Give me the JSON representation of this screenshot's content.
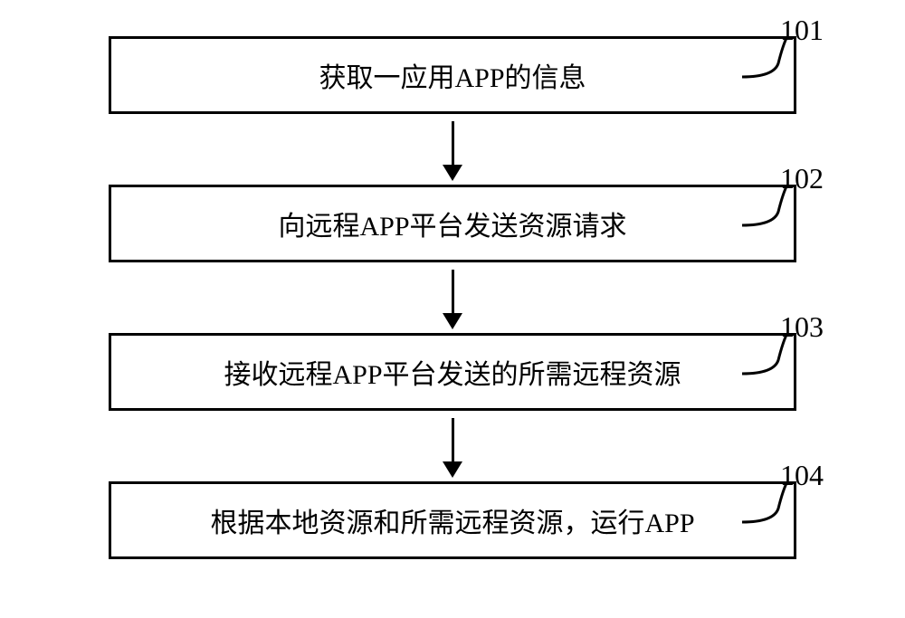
{
  "chart_data": {
    "type": "flowchart",
    "steps": [
      {
        "id": "101",
        "text": "获取一应用APP的信息"
      },
      {
        "id": "102",
        "text": "向远程APP平台发送资源请求"
      },
      {
        "id": "103",
        "text": "接收远程APP平台发送的所需远程资源"
      },
      {
        "id": "104",
        "text": "根据本地资源和所需远程资源，运行APP"
      }
    ]
  }
}
